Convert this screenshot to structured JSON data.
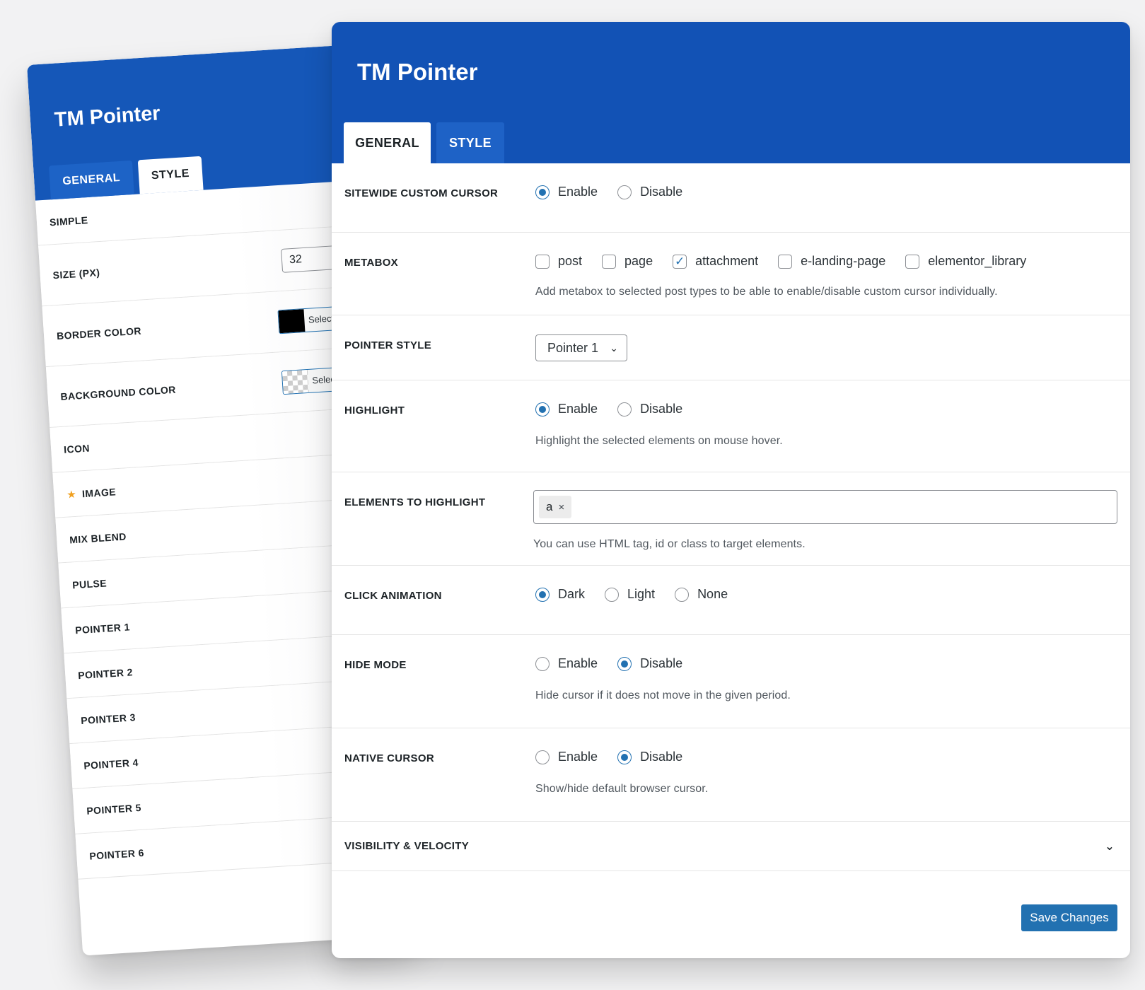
{
  "back_panel": {
    "title": "TM Pointer",
    "tabs": [
      {
        "label": "GENERAL",
        "active": false
      },
      {
        "label": "STYLE",
        "active": true
      }
    ],
    "rows": [
      {
        "label": "SIMPLE"
      },
      {
        "label": "SIZE (PX)",
        "value": "32"
      },
      {
        "label": "BORDER COLOR",
        "button": "Select Color",
        "swatch": "#000000"
      },
      {
        "label": "BACKGROUND COLOR",
        "button": "Select Color",
        "swatch": "transparent"
      },
      {
        "label": "ICON"
      },
      {
        "label": "IMAGE",
        "icon": "star-icon"
      },
      {
        "label": "MIX BLEND"
      },
      {
        "label": "PULSE"
      },
      {
        "label": "POINTER 1"
      },
      {
        "label": "POINTER 2"
      },
      {
        "label": "POINTER 3"
      },
      {
        "label": "POINTER 4"
      },
      {
        "label": "POINTER 5"
      },
      {
        "label": "POINTER 6"
      }
    ]
  },
  "front_panel": {
    "title": "TM Pointer",
    "tabs": [
      {
        "label": "GENERAL",
        "active": true
      },
      {
        "label": "STYLE",
        "active": false
      }
    ],
    "sitewide": {
      "label": "SITEWIDE CUSTOM CURSOR",
      "options": [
        {
          "label": "Enable",
          "checked": true
        },
        {
          "label": "Disable",
          "checked": false
        }
      ]
    },
    "metabox": {
      "label": "METABOX",
      "options": [
        {
          "label": "post",
          "checked": false
        },
        {
          "label": "page",
          "checked": false
        },
        {
          "label": "attachment",
          "checked": true
        },
        {
          "label": "e-landing-page",
          "checked": false
        },
        {
          "label": "elementor_library",
          "checked": false
        }
      ],
      "description": "Add metabox to selected post types to be able to enable/disable custom cursor individually."
    },
    "pointer_style": {
      "label": "POINTER STYLE",
      "selected": "Pointer 1"
    },
    "highlight": {
      "label": "HIGHLIGHT",
      "options": [
        {
          "label": "Enable",
          "checked": true
        },
        {
          "label": "Disable",
          "checked": false
        }
      ],
      "description": "Highlight the selected elements on mouse hover."
    },
    "elements_to_highlight": {
      "label": "ELEMENTS TO HIGHLIGHT",
      "tags": [
        "a"
      ],
      "tag_remove": "×",
      "description": "You can use HTML tag, id or class to target elements."
    },
    "click_animation": {
      "label": "CLICK ANIMATION",
      "options": [
        {
          "label": "Dark",
          "checked": true
        },
        {
          "label": "Light",
          "checked": false
        },
        {
          "label": "None",
          "checked": false
        }
      ]
    },
    "hide_mode": {
      "label": "HIDE MODE",
      "options": [
        {
          "label": "Enable",
          "checked": false
        },
        {
          "label": "Disable",
          "checked": true
        }
      ],
      "description": "Hide cursor if it does not move in the given period."
    },
    "native_cursor": {
      "label": "NATIVE CURSOR",
      "options": [
        {
          "label": "Enable",
          "checked": false
        },
        {
          "label": "Disable",
          "checked": true
        }
      ],
      "description": "Show/hide default browser cursor."
    },
    "visibility": {
      "label": "VISIBILITY & VELOCITY"
    },
    "save_label": "Save Changes"
  },
  "colors": {
    "header_blue": "#1252b5",
    "accent": "#2271b1"
  }
}
